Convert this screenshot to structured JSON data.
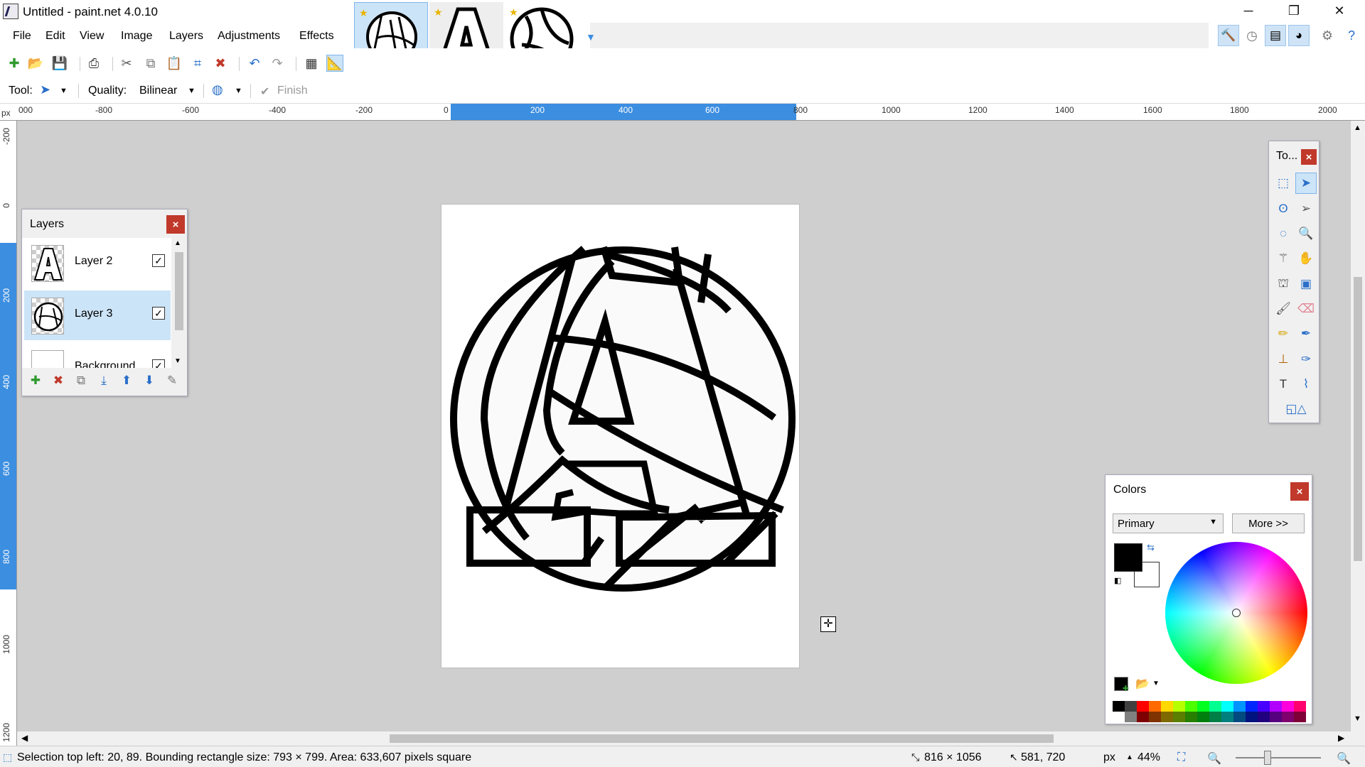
{
  "window": {
    "title": "Untitled - paint.net 4.0.10",
    "minimize": "─",
    "restore": "❐",
    "close": "✕"
  },
  "menu": [
    "File",
    "Edit",
    "View",
    "Image",
    "Layers",
    "Adjustments",
    "Effects"
  ],
  "toolbar_options": {
    "tool_label": "Tool:",
    "quality_label": "Quality:",
    "quality_value": "Bilinear",
    "finish_label": "Finish"
  },
  "ruler_top_labels": [
    "px",
    "000",
    "-800",
    "-600",
    "-400",
    "-200",
    "0",
    "200",
    "400",
    "600",
    "800",
    "1000",
    "1200",
    "1400",
    "1600",
    "1800",
    "2000"
  ],
  "ruler_left_labels": [
    "-200",
    "0",
    "200",
    "400",
    "600",
    "800",
    "1000",
    "1200"
  ],
  "layers_panel": {
    "title": "Layers",
    "items": [
      {
        "name": "Layer 2",
        "visible": true,
        "selected": false
      },
      {
        "name": "Layer 3",
        "visible": true,
        "selected": true
      },
      {
        "name": "Background",
        "visible": true,
        "selected": false
      }
    ]
  },
  "tools_panel": {
    "title": "To..."
  },
  "colors_panel": {
    "title": "Colors",
    "selector": "Primary",
    "more_button": "More >>",
    "primary_color": "#000000",
    "secondary_color": "#ffffff"
  },
  "palette": [
    "#000000",
    "#404040",
    "#ff0000",
    "#ff6a00",
    "#ffd800",
    "#b6ff00",
    "#4cff00",
    "#00ff21",
    "#00ff90",
    "#00ffff",
    "#0094ff",
    "#0026ff",
    "#4800ff",
    "#b200ff",
    "#ff00dc",
    "#ff006e"
  ],
  "palette_dark": [
    "#ffffff",
    "#808080",
    "#7f0000",
    "#7f3300",
    "#7f6a00",
    "#5b7f00",
    "#267f00",
    "#007f0e",
    "#007f46",
    "#007f7f",
    "#004a7f",
    "#00137f",
    "#21007f",
    "#57007f",
    "#7f006e",
    "#7f0037"
  ],
  "status": {
    "selection_info": "Selection top left: 20, 89. Bounding rectangle size: 793 × 799. Area: 633,607 pixels square",
    "image_size": "816 × 1056",
    "cursor_position": "581, 720",
    "units": "px",
    "zoom": "44%"
  },
  "colors": {
    "accent": "#3c8ee0",
    "selected_bg": "#cce4f7",
    "close_red": "#c0392b",
    "canvas_bg": "#cfcfcf"
  }
}
